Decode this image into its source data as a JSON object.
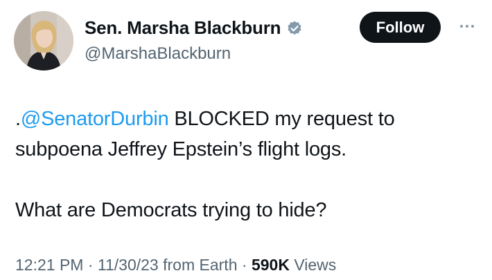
{
  "author": {
    "display_name": "Sen. Marsha Blackburn",
    "handle": "@MarshaBlackburn",
    "verified": true,
    "avatar_icon": "profile-photo"
  },
  "actions": {
    "follow_label": "Follow",
    "more_icon": "more-horizontal-icon"
  },
  "tweet": {
    "line1_prefix": ".",
    "mention": "@SenatorDurbin",
    "line1_rest": " BLOCKED my request to subpoena Jeffrey Epstein’s flight logs.",
    "paragraph2": "What are Democrats trying to hide?"
  },
  "meta": {
    "time": "12:21 PM",
    "separator1": " · ",
    "date": "11/30/23",
    "source": " from Earth",
    "separator2": " · ",
    "views_count": "590K",
    "views_label": " Views"
  },
  "colors": {
    "link": "#1d9bf0",
    "text": "#0f1419",
    "secondary": "#536471",
    "verified_badge": "#829aab",
    "button_bg": "#0f1419"
  }
}
